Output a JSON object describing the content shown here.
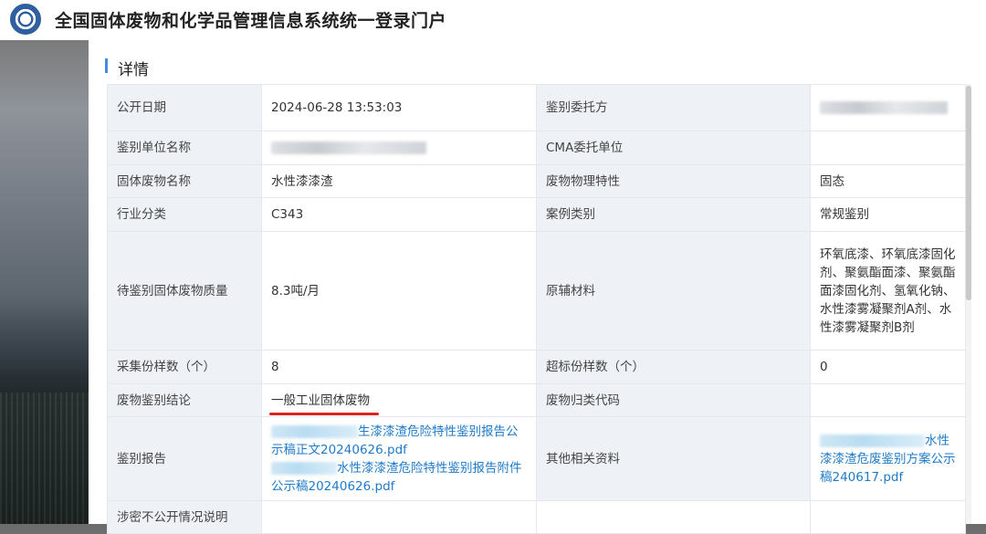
{
  "header": {
    "site_title": "全国固体废物和化学品管理信息系统统一登录门户"
  },
  "panel": {
    "title": "详情"
  },
  "rows": {
    "r1": {
      "label_a": "公开日期",
      "value_a": "2024-06-28 13:53:03",
      "label_b": "鉴别委托方",
      "value_b": ""
    },
    "r2": {
      "label_a": "鉴别单位名称",
      "value_a": "",
      "label_b": "CMA委托单位",
      "value_b": ""
    },
    "r3": {
      "label_a": "固体废物名称",
      "value_a": "水性漆漆渣",
      "label_b": "废物物理特性",
      "value_b": "固态"
    },
    "r4": {
      "label_a": "行业分类",
      "value_a": "C343",
      "label_b": "案例类别",
      "value_b": "常规鉴别"
    },
    "r5": {
      "label_a": "待鉴别固体废物质量",
      "value_a": "8.3吨/月",
      "label_b": "原辅材料",
      "value_b": "环氧底漆、环氧底漆固化剂、聚氨酯面漆、聚氨酯面漆固化剂、氢氧化钠、水性漆雾凝聚剂A剂、水性漆雾凝聚剂B剂"
    },
    "r6": {
      "label_a": "采集份样数（个）",
      "value_a": "8",
      "label_b": "超标份样数（个）",
      "value_b": "0"
    },
    "r7": {
      "label_a": "废物鉴别结论",
      "value_a": "一般工业固体废物",
      "label_b": "废物归类代码",
      "value_b": ""
    },
    "r8": {
      "label_a": "鉴别报告",
      "file1": "生漆漆渣危险特性鉴别报告公示稿正文20240626.pdf",
      "file2": "水性漆漆渣危险特性鉴别报告附件公示稿20240626.pdf",
      "label_b": "其他相关资料",
      "file3": "水性漆漆渣危废鉴别方案公示稿240617.pdf"
    },
    "r9": {
      "label_a": "涉密不公开情况说明",
      "value_a": ""
    }
  },
  "colors": {
    "label_bg": "#eef2f7",
    "link": "#1f7ac9",
    "accent": "#3f8fe0",
    "annotation_underline": "#d9231e"
  }
}
